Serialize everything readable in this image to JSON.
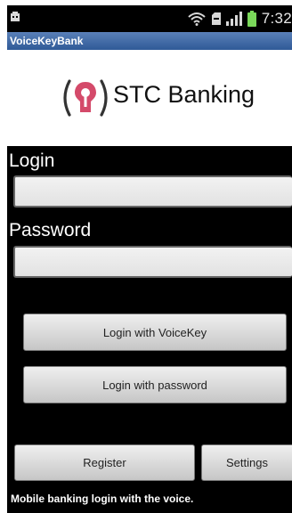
{
  "status_bar": {
    "time": "7:32",
    "icons": [
      "usb-icon",
      "wifi-icon",
      "sd-card-icon",
      "signal-icon",
      "battery-icon"
    ]
  },
  "app": {
    "title": "VoiceKeyBank"
  },
  "logo": {
    "text": "STC Banking",
    "icon": "keyhole-icon"
  },
  "form": {
    "login_label": "Login",
    "login_value": "",
    "password_label": "Password",
    "password_value": ""
  },
  "buttons": {
    "login_voicekey": "Login with VoiceKey",
    "login_password": "Login with password",
    "register": "Register",
    "settings": "Settings"
  },
  "footer": {
    "text": "Mobile banking login with the voice."
  },
  "colors": {
    "title_bar": "#3a66a6",
    "background": "#000000",
    "keyhole_accent": "#d44a6a"
  }
}
